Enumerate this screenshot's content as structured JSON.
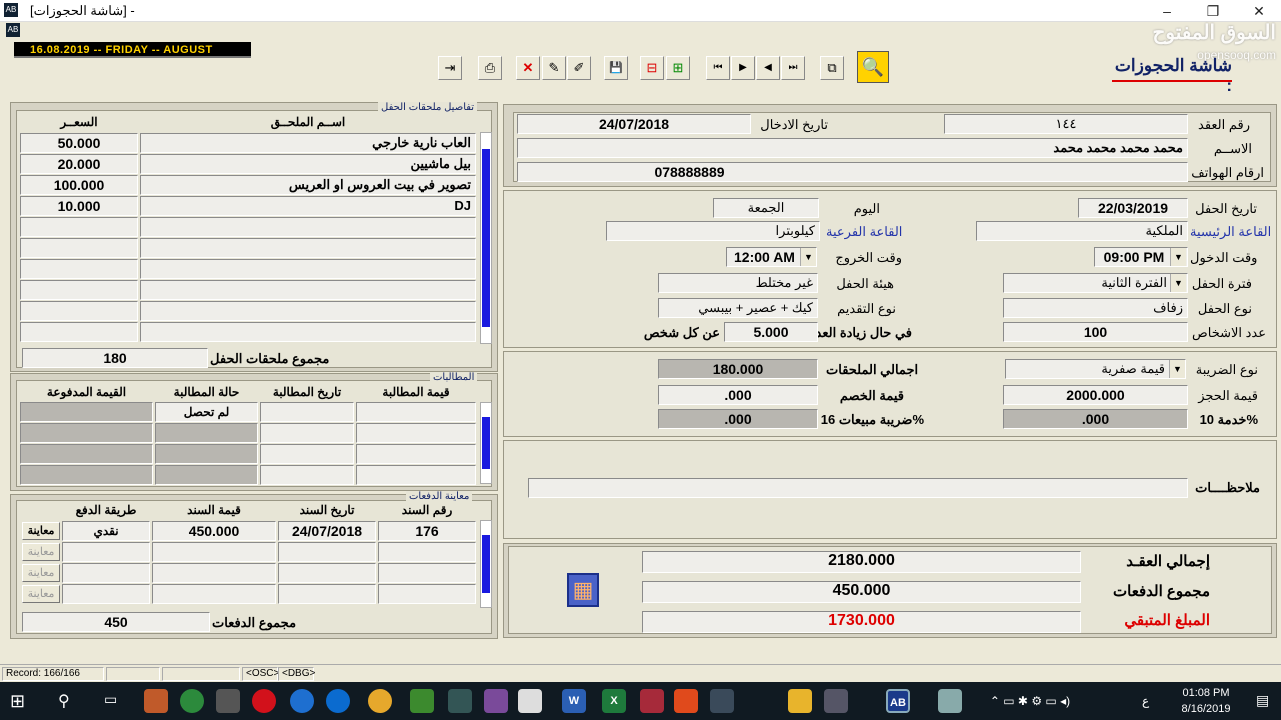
{
  "window": {
    "title": "[شاشة الحجوزات] -",
    "min": "–",
    "max": "❐",
    "close": "✕"
  },
  "datebar": {
    "text": "16.08.2019 -- FRIDAY    -- AUGUST"
  },
  "logo": {
    "arabic": "السوق المفتوح",
    "latin": "opensooq.com"
  },
  "screen_title": "شاشة الحجوزات :",
  "toolbar": {
    "exit": "⇥",
    "print": "⎙",
    "delete": "✕",
    "edit1": "✎",
    "edit2": "✐",
    "save": "💾",
    "remove": "⊟",
    "add": "⊞",
    "first": "⏮",
    "next": "▶",
    "prev": "◀",
    "last": "⏭",
    "copy": "⧉",
    "search": "🔍"
  },
  "header": {
    "contract_no_label": "رقم العقد",
    "contract_no": "١٤٤",
    "entry_date_label": "تاريخ الادخال",
    "entry_date": "24/07/2018",
    "name_label": "الاســم",
    "name": "محمد محمد محمد محمد",
    "phones_label": "ارقام الهواتف",
    "phones": "078888889"
  },
  "event": {
    "party_date_label": "تاريخ الحفل",
    "party_date": "22/03/2019",
    "day_label": "اليوم",
    "day": "الجمعة",
    "main_hall_label": "القاعة الرئيسية",
    "main_hall": "الملكية",
    "sub_hall_label": "القاعة الفرعية",
    "sub_hall": "كيلوبترا",
    "entry_time_label": "وقت الدخول",
    "entry_time": "09:00 PM",
    "exit_time_label": "وقت الخروج",
    "exit_time": "12:00 AM",
    "period_label": "فترة الحفل",
    "period": "الفترة الثانية",
    "form_label": "هيئة الحفل",
    "form": "غير مختلط",
    "type_label": "نوع الحفل",
    "type": "زفاف",
    "serving_label": "نوع التقديم",
    "serving": "كيك + عصير + بيبسي",
    "persons_label": "عدد الاشخاص",
    "persons": "100",
    "increase_label": "في حال زيادة العدد",
    "increase": "5.000",
    "per_person_label": "عن كل شخص"
  },
  "finance": {
    "tax_type_label": "نوع الضريبة",
    "tax_type": "قيمة صفرية",
    "addons_total_label": "اجمالي الملحقات",
    "addons_total": "180.000",
    "booking_value_label": "قيمة الحجز",
    "booking_value": "2000.000",
    "discount_label": "قيمة الخصم",
    "discount": ".000",
    "service_label": "خدمة 10%",
    "service": ".000",
    "sales_tax_label": "ضريبة مبيعات 16%",
    "sales_tax": ".000"
  },
  "notes": {
    "label": "ملاحظــــات",
    "value": ""
  },
  "totals": {
    "contract_total_label": "إجمالي العقـد",
    "contract_total": "2180.000",
    "payments_total_label": "مجموع الدفعات",
    "payments_total": "450.000",
    "remaining_label": "المبلغ المتبقي",
    "remaining": "1730.000",
    "calculator_icon": "▦"
  },
  "addons": {
    "group_title": "تفاصيل ملحقات الحفل",
    "col_name": "اســم الملحــق",
    "col_price": "السعــر",
    "rows": [
      {
        "name": "العاب نارية خارجي",
        "price": "50.000"
      },
      {
        "name": "بيل ماشيين",
        "price": "20.000"
      },
      {
        "name": "تصوير في بيت العروس او العريس",
        "price": "100.000"
      },
      {
        "name": "DJ",
        "price": "10.000"
      }
    ],
    "total_label": "مجموع ملحقات الحفل",
    "total": "180"
  },
  "claims": {
    "group_title": "المطالبات",
    "col_value": "قيمة المطالبة",
    "col_date": "تاريخ المطالبة",
    "col_status": "حالة المطالبة",
    "col_paid": "القيمة المدفوعة",
    "rows": [
      {
        "status": "لم تحصل"
      }
    ]
  },
  "payments": {
    "group_title": "معاينة الدفعات",
    "col_no": "رقم السند",
    "col_date": "تاريخ السند",
    "col_value": "قيمة السند",
    "col_method": "طريقة الدفع",
    "rows": [
      {
        "no": "176",
        "date": "24/07/2018",
        "value": "450.000",
        "method": "نقدي"
      }
    ],
    "view_label": "معاينة",
    "total_label": "مجموع الدفعات",
    "total": "450"
  },
  "status": {
    "record": "Record: 166/166",
    "osc": "<OSC>",
    "dbg": "<DBG>"
  },
  "taskbar": {
    "time": "01:08 PM",
    "date": "8/16/2019",
    "lang": "ع"
  }
}
